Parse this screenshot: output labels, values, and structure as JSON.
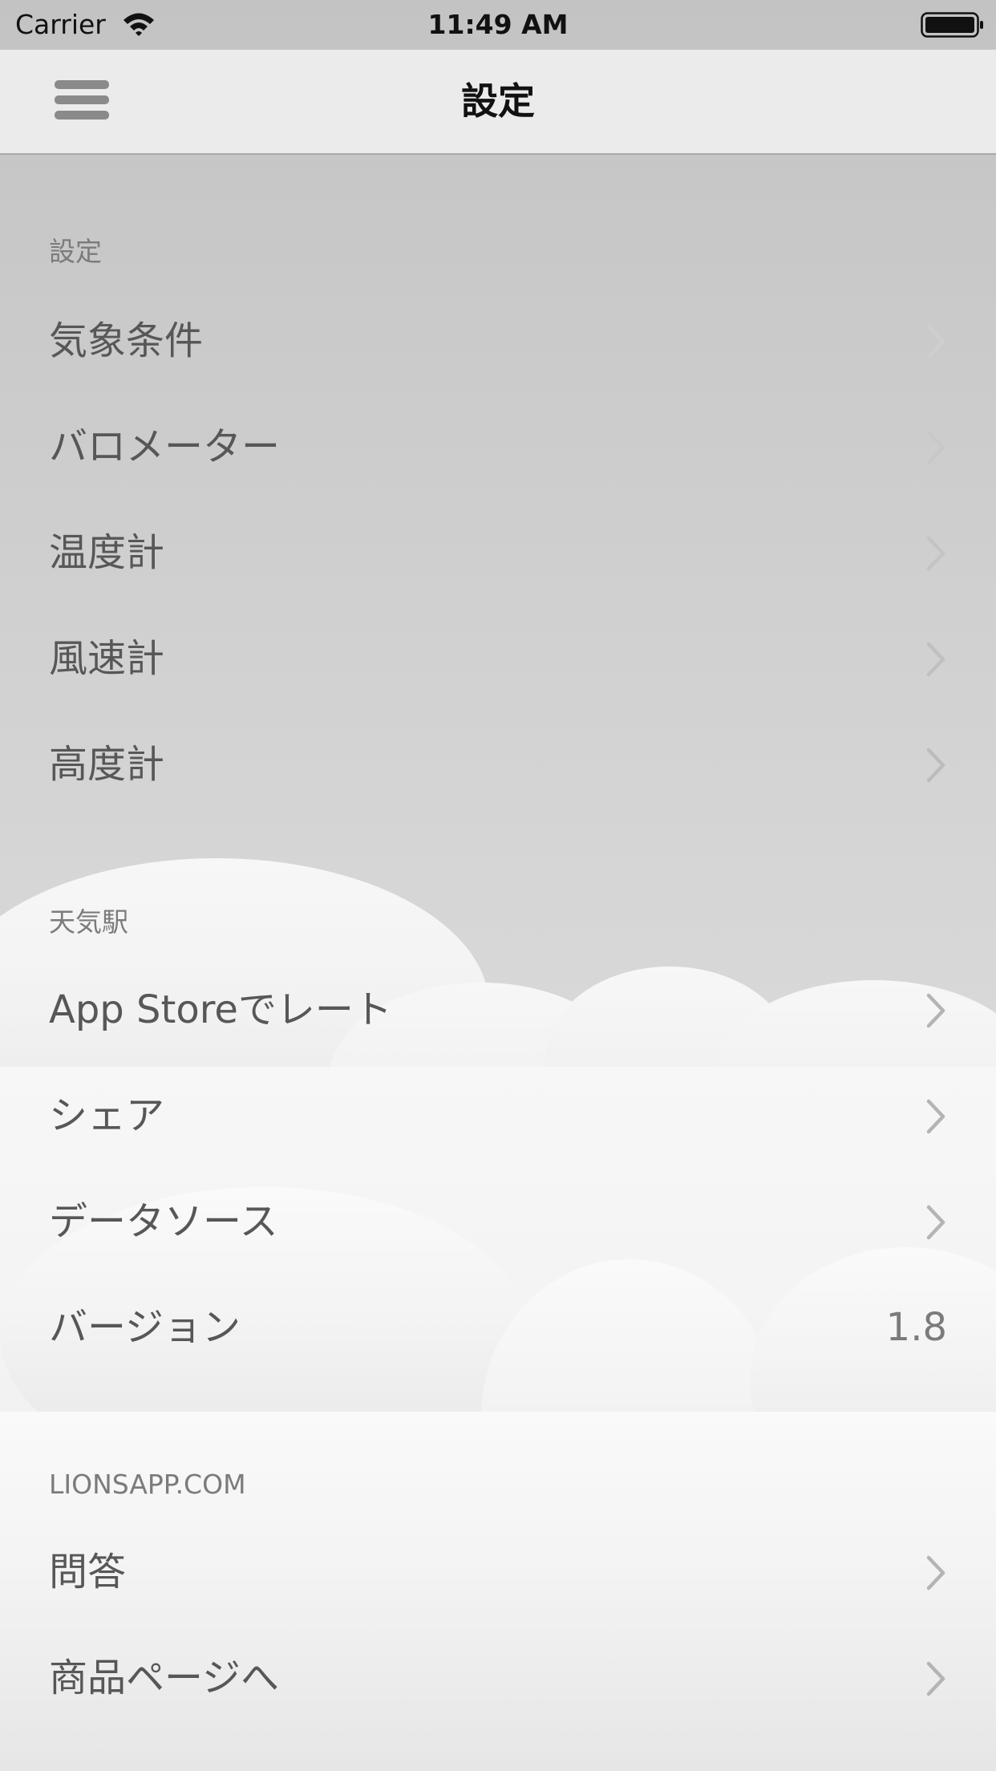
{
  "status_bar": {
    "carrier": "Carrier",
    "time": "11:49 AM",
    "wifi_icon": "wifi-icon",
    "battery_icon": "battery-full-icon"
  },
  "nav_bar": {
    "title": "設定",
    "menu_icon": "hamburger-menu-icon"
  },
  "sections": [
    {
      "header": "設定",
      "rows": [
        {
          "label": "気象条件",
          "accessory": "chevron"
        },
        {
          "label": "バロメーター",
          "accessory": "chevron"
        },
        {
          "label": "温度計",
          "accessory": "chevron"
        },
        {
          "label": "風速計",
          "accessory": "chevron"
        },
        {
          "label": "高度計",
          "accessory": "chevron"
        }
      ]
    },
    {
      "header": "天気駅",
      "rows": [
        {
          "label": "App Storeでレート",
          "accessory": "chevron"
        },
        {
          "label": "シェア",
          "accessory": "chevron"
        },
        {
          "label": "データソース",
          "accessory": "chevron"
        },
        {
          "label": "バージョン",
          "value": "1.8"
        }
      ]
    },
    {
      "header": "LIONSAPP.COM",
      "rows": [
        {
          "label": "問答",
          "accessory": "chevron"
        },
        {
          "label": "商品ページへ",
          "accessory": "chevron"
        }
      ]
    }
  ],
  "colors": {
    "row_text": "#575757",
    "header_text": "#7b7b7b",
    "chevron": "#b4b4b4",
    "nav_bg": "#ececec"
  }
}
